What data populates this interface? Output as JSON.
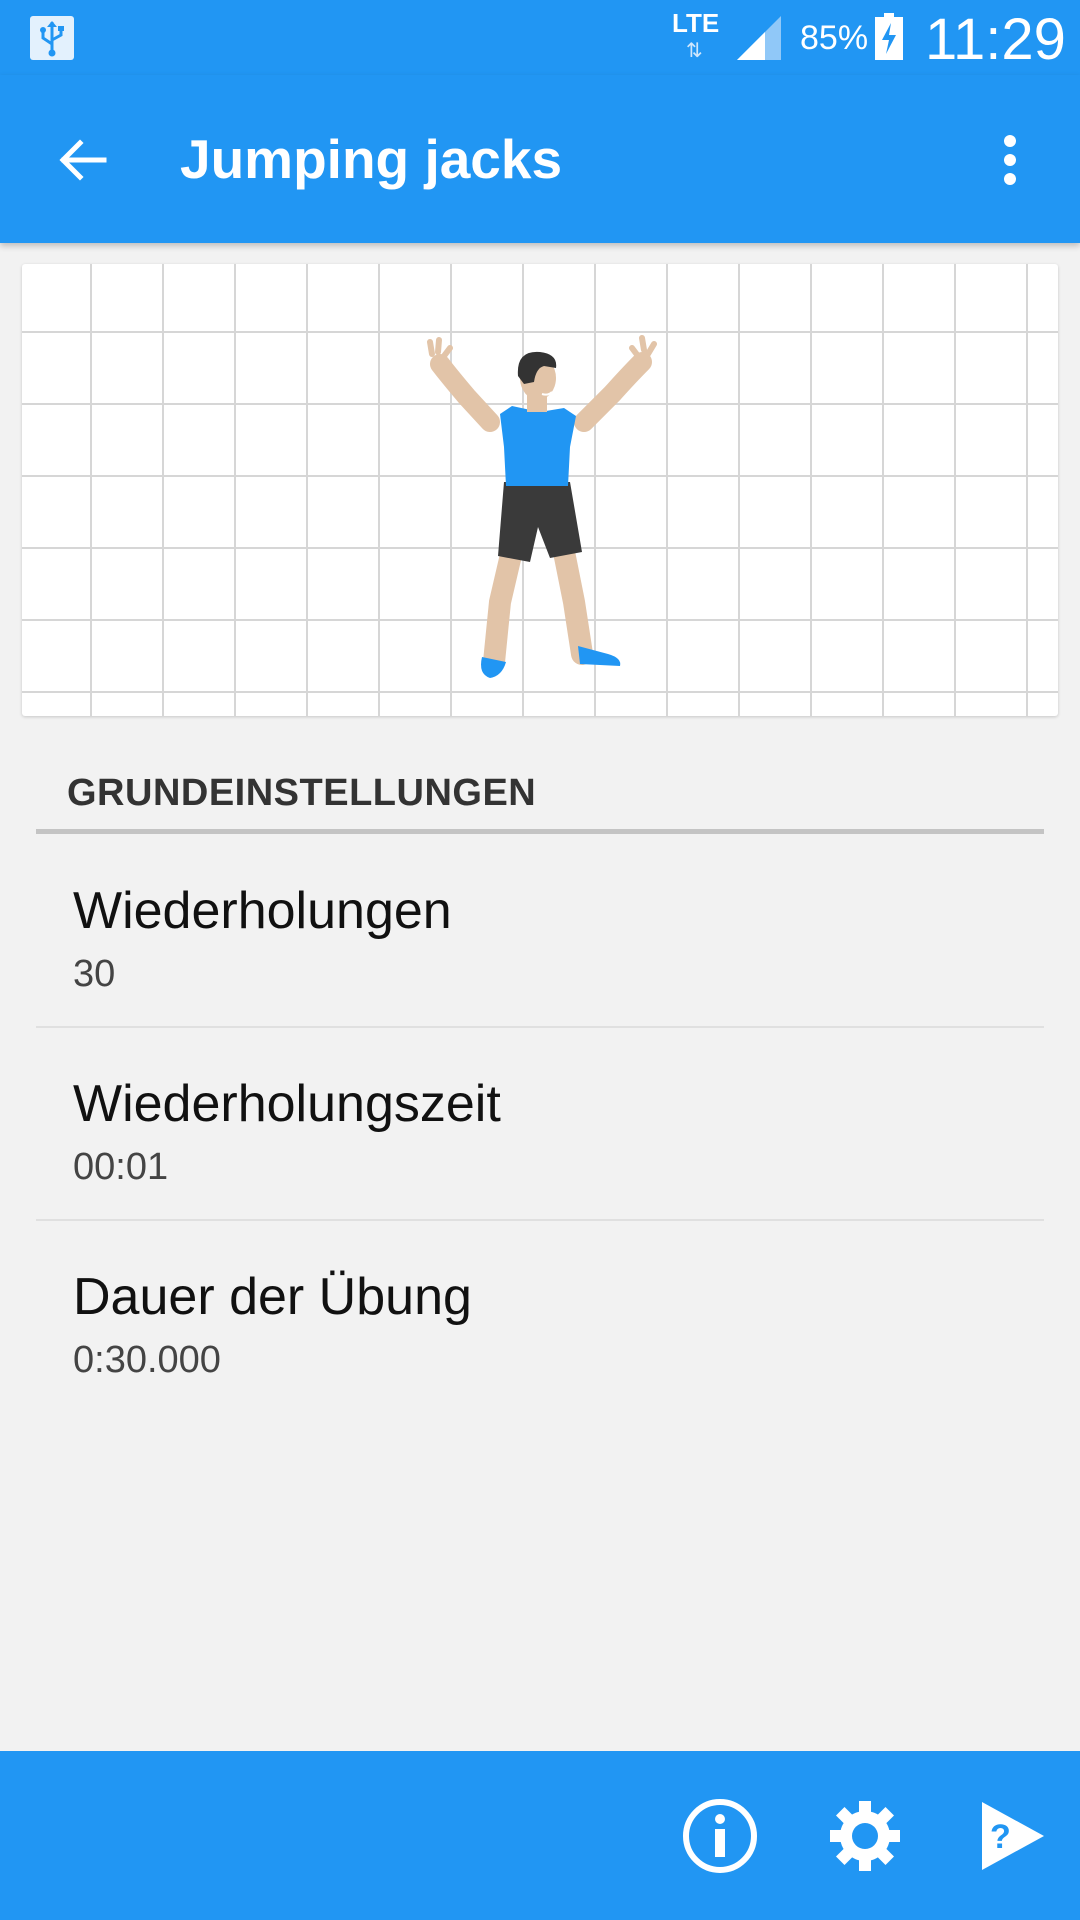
{
  "status_bar": {
    "network": "LTE",
    "battery": "85%",
    "time": "11:29",
    "icons": [
      "usb-icon",
      "signal-icon",
      "battery-charging-icon"
    ]
  },
  "toolbar": {
    "title": "Jumping jacks",
    "back_icon": "arrow-back-icon",
    "menu_icon": "more-vert-icon"
  },
  "exercise_image": {
    "description_icon": "jumping-jacks-figure"
  },
  "settings": {
    "section_title": "GRUNDEINSTELLUNGEN",
    "items": [
      {
        "title": "Wiederholungen",
        "value": "30"
      },
      {
        "title": "Wiederholungszeit",
        "value": "00:01"
      },
      {
        "title": "Dauer der Übung",
        "value": "0:30.000"
      }
    ]
  },
  "bottom_bar": {
    "buttons": [
      "info-icon",
      "settings-gear-icon",
      "help-play-icon"
    ]
  },
  "colors": {
    "primary": "#2196f3",
    "background": "#f2f2f2",
    "shirt": "#2196f3",
    "shorts": "#3a3a3a",
    "skin": "#e2c4a8"
  }
}
